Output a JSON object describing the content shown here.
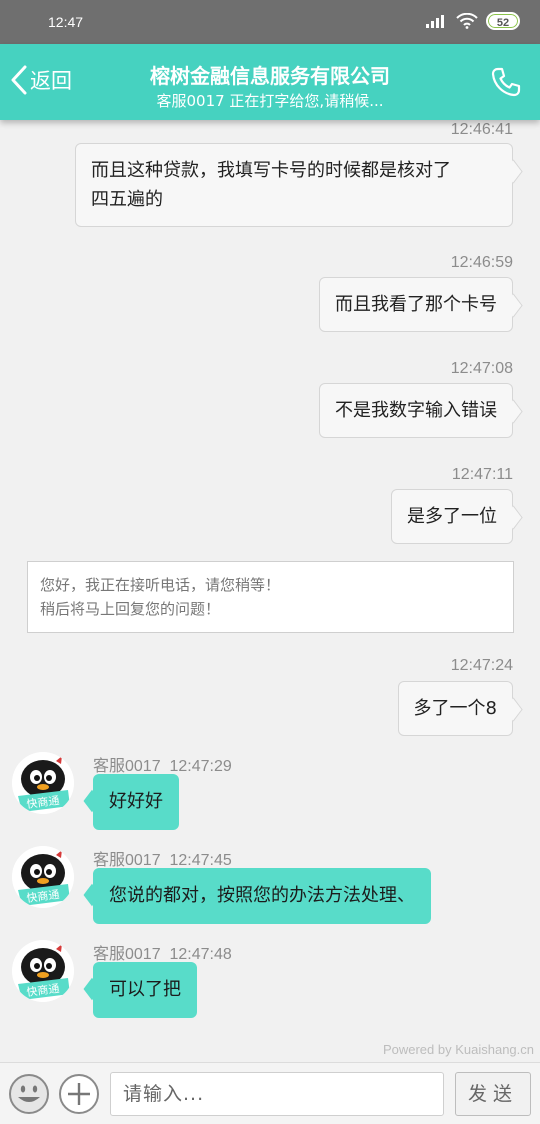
{
  "status_bar": {
    "time": "12:47",
    "battery": "52"
  },
  "header": {
    "back_label": "返回",
    "title": "榕树金融信息服务有限公司",
    "subtitle": "客服0017 正在打字给您,请稍候..."
  },
  "messages": {
    "m1": {
      "time": "12:46:41",
      "text1": "而且这种贷款，我填写卡号的时候都是核对了",
      "text2": "四五遍的"
    },
    "m2": {
      "time": "12:46:59",
      "text": "而且我看了那个卡号"
    },
    "m3": {
      "time": "12:47:08",
      "text": "不是我数字输入错误"
    },
    "m4": {
      "time": "12:47:11",
      "text": "是多了一位"
    },
    "notice": {
      "line1": "您好，我正在接听电话，请您稍等！",
      "line2": "稍后将马上回复您的问题！"
    },
    "m5": {
      "time": "12:47:24",
      "text": "多了一个8"
    },
    "a1": {
      "agent": "客服0017",
      "time": "12:47:29",
      "text": "好好好"
    },
    "a2": {
      "agent": "客服0017",
      "time": "12:47:45",
      "text": "您说的都对，按照您的办法方法处理、"
    },
    "a3": {
      "agent": "客服0017",
      "time": "12:47:48",
      "text": "可以了把"
    }
  },
  "avatar_label": "快商通",
  "powered_by": "Powered by Kuaishang.cn",
  "input": {
    "placeholder": "请输入...",
    "send_label": "发送"
  },
  "colors": {
    "accent": "#46d2c0",
    "agent_bubble": "#58dcc9",
    "status_bar": "#6f6f6f"
  }
}
